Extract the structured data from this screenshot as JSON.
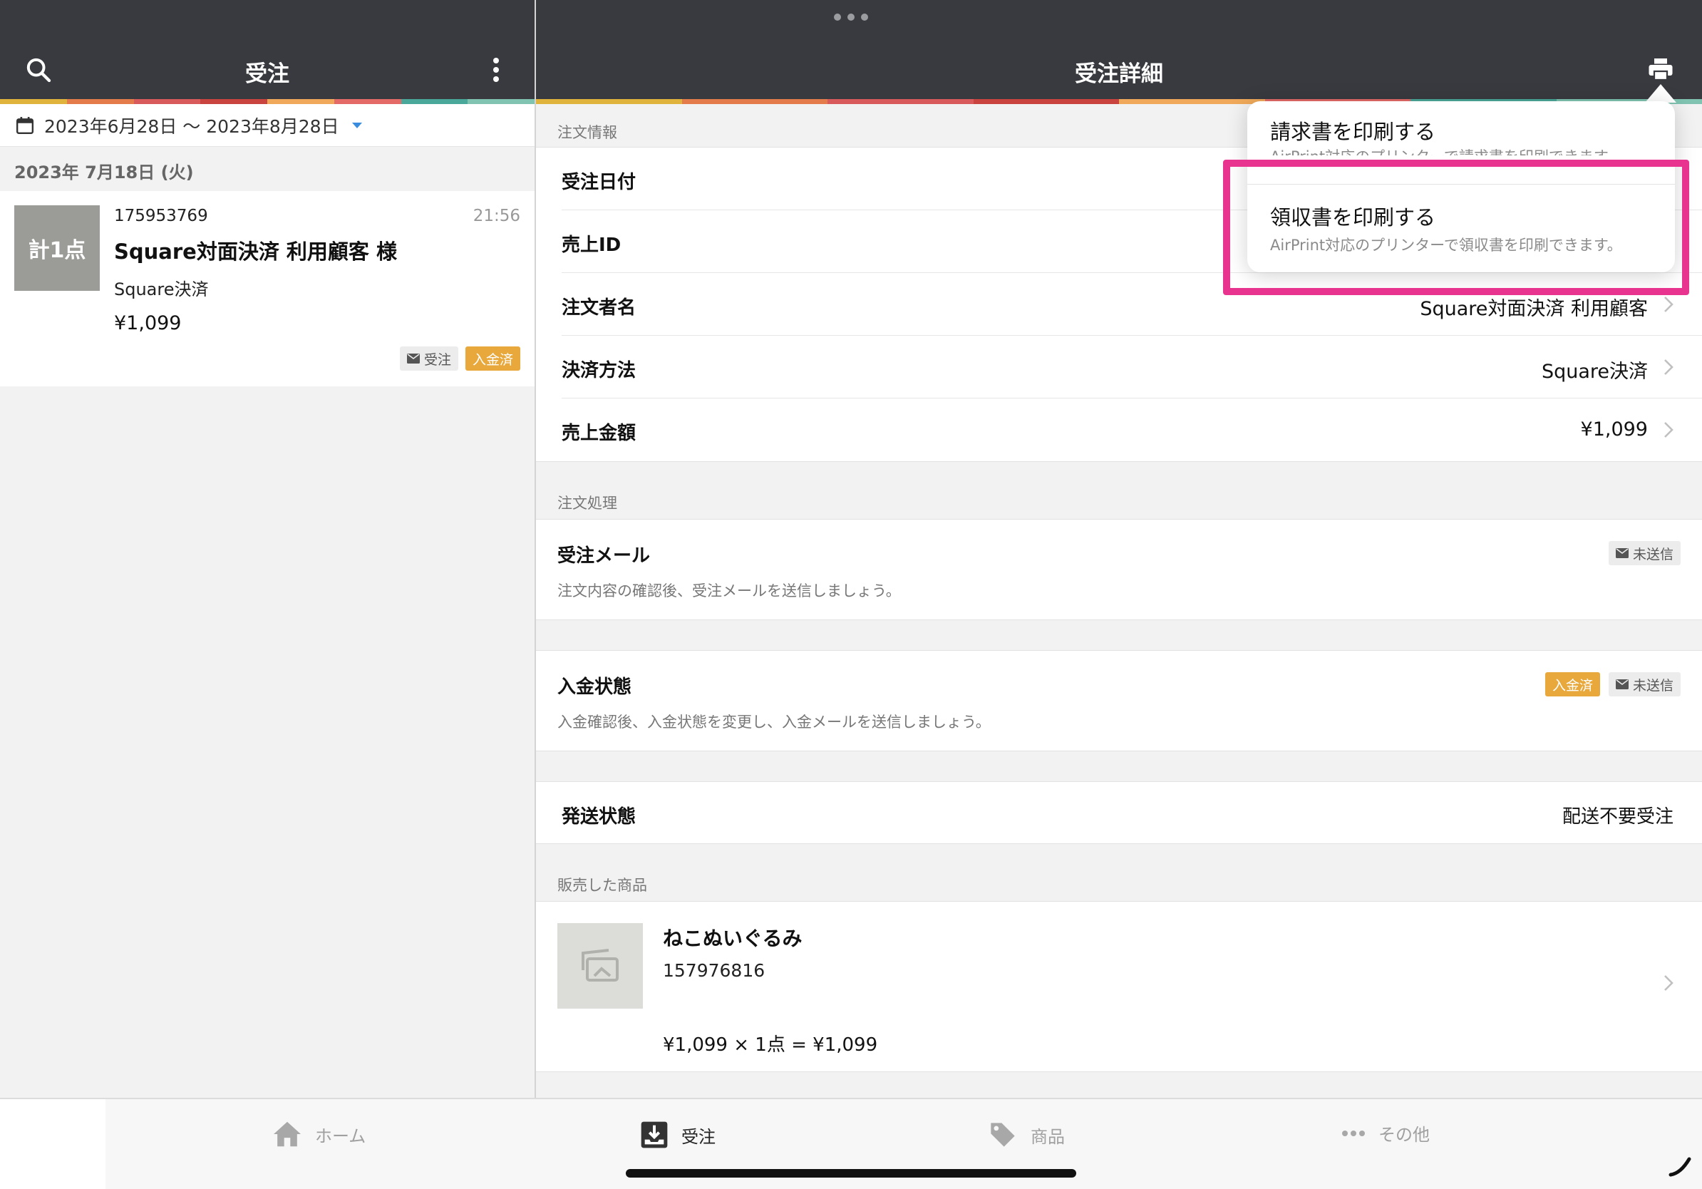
{
  "colors": {
    "topbar": "#383a3f",
    "stripe": [
      "#e0b33d",
      "#e47b4b",
      "#d85a5a",
      "#c9443f",
      "#f0a95a",
      "#e36a67",
      "#4aa89a",
      "#7fc3b0"
    ],
    "paid_badge": "#e8a83c",
    "highlight": "#e8338f",
    "caret": "#3a8dde"
  },
  "left": {
    "title": "受注",
    "search_icon": "search-icon",
    "more_icon": "more-vertical-icon",
    "date_range": "2023年6月28日 〜 2023年8月28日",
    "day_header": "2023年 7月18日 (火)",
    "order": {
      "thumb_label": "計1点",
      "number": "175953769",
      "time": "21:56",
      "name": "Square対面決済 利用顧客 様",
      "payment": "Square決済",
      "price": "¥1,099",
      "badge_order": "受注",
      "badge_paid": "入金済"
    }
  },
  "right": {
    "title": "受注詳細",
    "print_icon": "printer-icon",
    "section_order_info": "注文情報",
    "rows": [
      {
        "key": "受注日付",
        "value": ""
      },
      {
        "key": "売上ID",
        "value": ""
      },
      {
        "key": "注文者名",
        "value": "Square対面決済 利用顧客"
      },
      {
        "key": "決済方法",
        "value": "Square決済"
      },
      {
        "key": "売上金額",
        "value": "¥1,099"
      }
    ],
    "section_processing": "注文処理",
    "order_mail": {
      "title": "受注メール",
      "desc": "注文内容の確認後、受注メールを送信しましょう。",
      "badge": "未送信"
    },
    "payment_status": {
      "title": "入金状態",
      "desc": "入金確認後、入金状態を変更し、入金メールを送信しましょう。",
      "badge_paid": "入金済",
      "badge_mail": "未送信"
    },
    "shipping": {
      "key": "発送状態",
      "value": "配送不要受注"
    },
    "section_products": "販売した商品",
    "product": {
      "name": "ねこぬいぐるみ",
      "id": "157976816",
      "calc": "¥1,099 × 1点 = ¥1,099"
    }
  },
  "popover": {
    "invoice_title": "請求書を印刷する",
    "invoice_desc": "AirPrint対応のプリンターで請求書を印刷できます。",
    "receipt_title": "領収書を印刷する",
    "receipt_desc": "AirPrint対応のプリンターで領収書を印刷できます。"
  },
  "tabbar": {
    "home": "ホーム",
    "orders": "受注",
    "products": "商品",
    "other": "その他"
  }
}
